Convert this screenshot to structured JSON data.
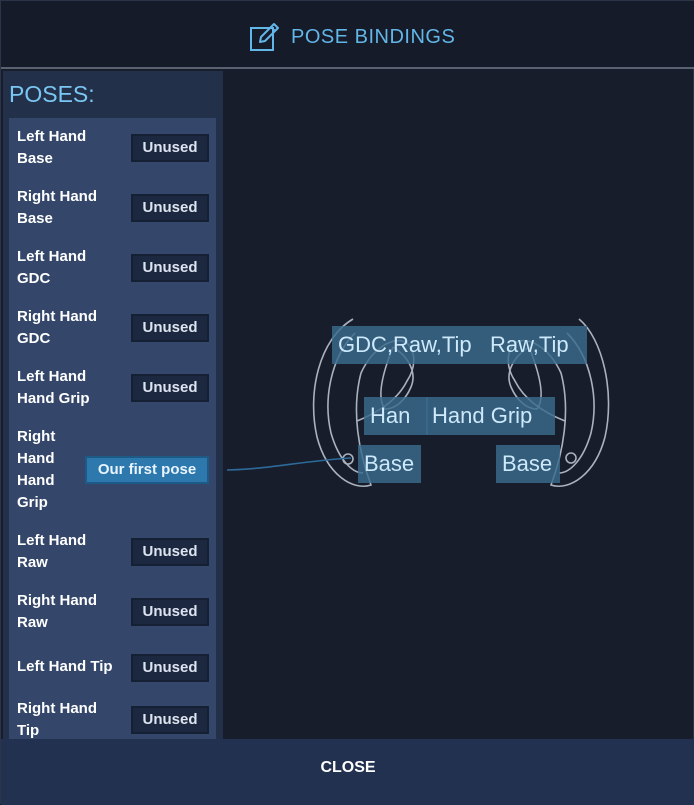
{
  "header": {
    "title": "POSE BINDINGS",
    "icon": "edit-icon"
  },
  "poses": {
    "title": "POSES:",
    "items": [
      {
        "label_lines": [
          "Left Hand",
          "Base"
        ],
        "button": "Unused"
      },
      {
        "label_lines": [
          "Right Hand",
          "Base"
        ],
        "button": "Unused"
      },
      {
        "label_lines": [
          "Left Hand",
          "GDC"
        ],
        "button": "Unused"
      },
      {
        "label_lines": [
          "Right Hand",
          "GDC"
        ],
        "button": "Unused"
      },
      {
        "label_lines": [
          "Left Hand",
          "Hand Grip"
        ],
        "button": "Unused"
      },
      {
        "label_lines": [
          "Right",
          "Hand",
          "Hand",
          "Grip"
        ],
        "button": "Our first pose"
      },
      {
        "label_lines": [
          "Left Hand",
          "Raw"
        ],
        "button": "Unused"
      },
      {
        "label_lines": [
          "Right Hand",
          "Raw"
        ],
        "button": "Unused"
      },
      {
        "label_lines": [
          "Left Hand Tip"
        ],
        "button": "Unused"
      },
      {
        "label_lines": [
          "Right Hand",
          "Tip"
        ],
        "button": "Unused"
      }
    ]
  },
  "controller_tags": {
    "left_gdc_raw_tip": "GDC,Raw,Tip",
    "right_gdc_raw_tip": "Raw,Tip",
    "left_hand_grip": "Han",
    "right_hand_grip": "Hand Grip",
    "left_base": "Base",
    "right_base": "Base"
  },
  "footer": {
    "close_label": "CLOSE"
  },
  "colors": {
    "accent": "#62b6e8",
    "active_button": "#2d78ad",
    "panel": "#233049",
    "list": "#34476a"
  }
}
